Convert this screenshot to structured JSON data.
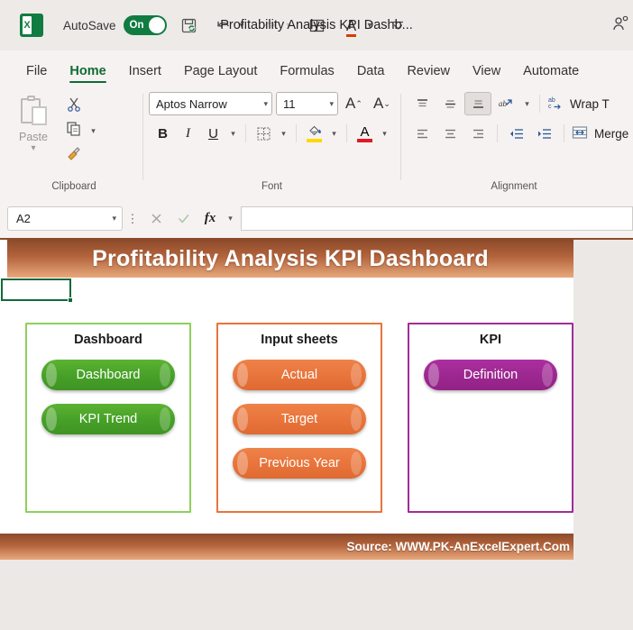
{
  "titlebar": {
    "app_logo": "excel-logo",
    "logo_letter": "X",
    "autosave_label": "AutoSave",
    "autosave_state": "On",
    "document_title": "Profitability Analysis KPI Dashb...",
    "quick_access": [
      {
        "name": "save-icon",
        "glyph": "🖫"
      },
      {
        "name": "undo-icon",
        "glyph": "↶"
      },
      {
        "name": "redo-icon",
        "glyph": "↷"
      },
      {
        "name": "table-icon",
        "glyph": "⊞"
      },
      {
        "name": "font-color-icon",
        "glyph": "A"
      },
      {
        "name": "customize-toolbar-icon",
        "glyph": "⌄"
      }
    ],
    "share_icon": "person-add-icon"
  },
  "ribbon_tabs": [
    {
      "label": "File",
      "active": false
    },
    {
      "label": "Home",
      "active": true
    },
    {
      "label": "Insert",
      "active": false
    },
    {
      "label": "Page Layout",
      "active": false
    },
    {
      "label": "Formulas",
      "active": false
    },
    {
      "label": "Data",
      "active": false
    },
    {
      "label": "Review",
      "active": false
    },
    {
      "label": "View",
      "active": false
    },
    {
      "label": "Automate",
      "active": false
    }
  ],
  "ribbon": {
    "clipboard": {
      "group_label": "Clipboard",
      "paste_label": "Paste",
      "cut_icon": "scissors-icon",
      "copy_icon": "copy-icon",
      "format_painter_icon": "format-painter-icon",
      "dialog_launcher": "↘"
    },
    "font": {
      "group_label": "Font",
      "font_name": "Aptos Narrow",
      "font_size": "11",
      "grow_font": "A",
      "shrink_font": "A",
      "bold": "B",
      "italic": "I",
      "underline": "U",
      "borders_icon": "borders-icon",
      "fill_color_icon": "fill-color-icon",
      "fill_color": "#ffd900",
      "font_color_icon": "font-color-icon",
      "font_color": "#e01b24",
      "dialog_launcher": "↘"
    },
    "alignment": {
      "group_label": "Alignment",
      "align_top": "align-top-icon",
      "align_middle": "align-middle-icon",
      "align_bottom": "align-bottom-icon",
      "orientation": "orientation-icon",
      "align_left": "align-left-icon",
      "align_center": "align-center-icon",
      "align_right": "align-right-icon",
      "decrease_indent": "decrease-indent-icon",
      "increase_indent": "increase-indent-icon",
      "wrap_text_label": "Wrap T",
      "merge_label": "Merge"
    }
  },
  "formula_bar": {
    "name_box_value": "A2",
    "cancel_icon": "cancel-icon",
    "enter_icon": "enter-icon",
    "fx_label": "fx",
    "formula_value": ""
  },
  "worksheet": {
    "banner_title": "Profitability Analysis KPI Dashboard",
    "banner_gradient_start": "#8c4a2a",
    "banner_gradient_end": "#e8a87c",
    "selected_cell": "A2",
    "panels": [
      {
        "title": "Dashboard",
        "border_color": "#8ed05c",
        "buttons": [
          {
            "label": "Dashboard",
            "color": "green"
          },
          {
            "label": "KPI Trend",
            "color": "green"
          }
        ]
      },
      {
        "title": "Input sheets",
        "border_color": "#e8743b",
        "buttons": [
          {
            "label": "Actual",
            "color": "orange"
          },
          {
            "label": "Target",
            "color": "orange"
          },
          {
            "label": "Previous Year",
            "color": "orange"
          }
        ]
      },
      {
        "title": "KPI",
        "border_color": "#a12c97",
        "buttons": [
          {
            "label": "Definition",
            "color": "purple"
          }
        ]
      }
    ],
    "footer_text": "Source: WWW.PK-AnExcelExpert.Com"
  }
}
